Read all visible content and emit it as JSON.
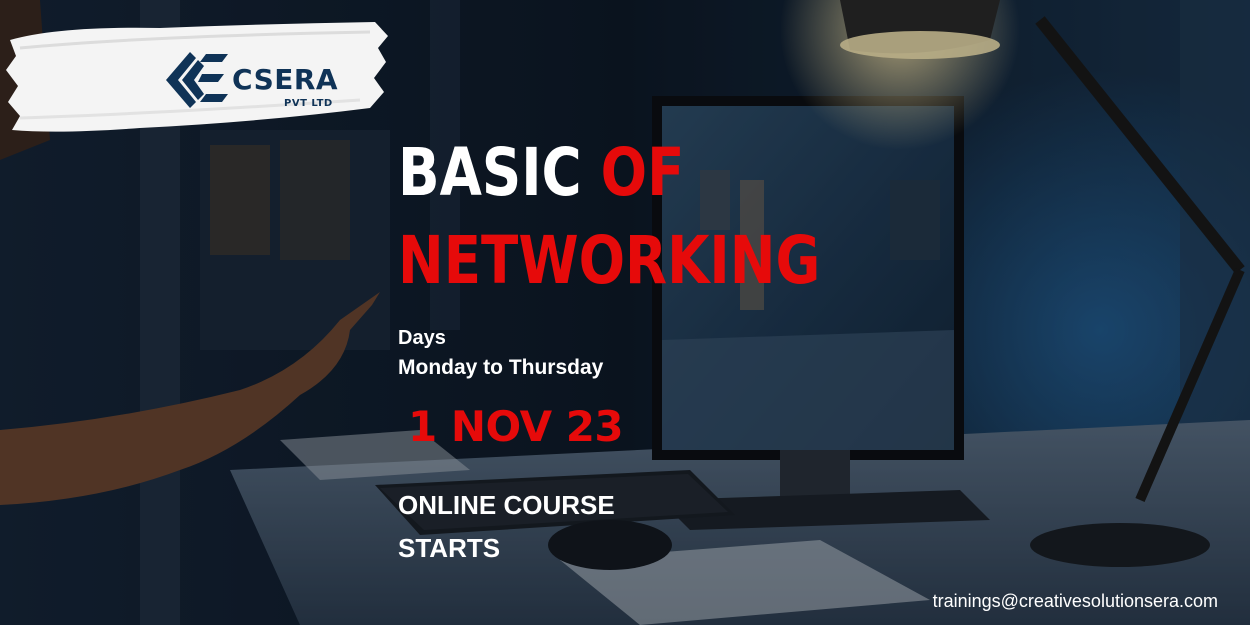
{
  "brand": {
    "name": "CSERA",
    "subtitle": "PVT LTD",
    "logo_icon": "csera-logo-icon",
    "color": "#0f3357"
  },
  "headline": {
    "word1": "BASIC",
    "word2": "OF",
    "word3": "NETWORKING",
    "color_white": "#ffffff",
    "color_red": "#e60a0a"
  },
  "schedule": {
    "days_label": "Days",
    "days_value": "Monday to Thursday",
    "date": "1 NOV 23"
  },
  "course": {
    "line1": "ONLINE COURSE",
    "line2": "STARTS"
  },
  "contact": {
    "email": "trainings@creativesolutionsera.com"
  }
}
